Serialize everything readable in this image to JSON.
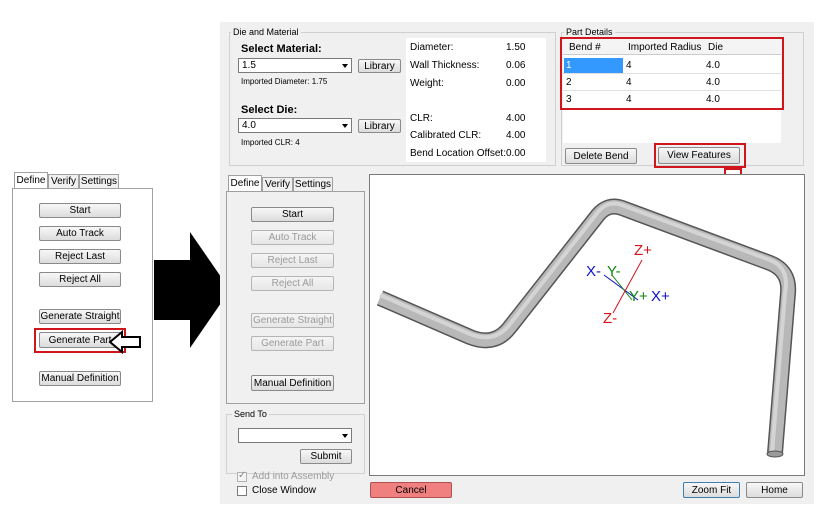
{
  "left_panel": {
    "tabs": [
      "Define",
      "Verify",
      "Settings"
    ],
    "buttons": [
      "Start",
      "Auto Track",
      "Reject Last",
      "Reject All",
      "Generate Straight",
      "Generate Part",
      "Manual Definition"
    ]
  },
  "main": {
    "die_material": {
      "title": "Die and Material",
      "select_material_label": "Select Material:",
      "material_value": "1.5",
      "library_label": "Library",
      "imported_diameter": "Imported Diameter: 1.75",
      "select_die_label": "Select Die:",
      "die_value": "4.0",
      "imported_clr": "Imported CLR: 4",
      "props": [
        {
          "label": "Diameter:",
          "value": "1.50"
        },
        {
          "label": "Wall Thickness:",
          "value": "0.06"
        },
        {
          "label": "Weight:",
          "value": "0.00"
        },
        {
          "label": "CLR:",
          "value": "4.00"
        },
        {
          "label": "Calibrated CLR:",
          "value": "4.00"
        },
        {
          "label": "Bend Location Offset:",
          "value": "0.00"
        }
      ]
    },
    "part_details": {
      "title": "Part Details",
      "columns": [
        "Bend #",
        "Imported Radius",
        "Die"
      ],
      "rows": [
        [
          "1",
          "4",
          "4.0"
        ],
        [
          "2",
          "4",
          "4.0"
        ],
        [
          "3",
          "4",
          "4.0"
        ]
      ],
      "delete_bend_label": "Delete Bend",
      "view_features_label": "View Features"
    },
    "define_panel": {
      "tabs": [
        "Define",
        "Verify",
        "Settings"
      ],
      "buttons": [
        "Start",
        "Auto Track",
        "Reject Last",
        "Reject All",
        "Generate Straight",
        "Generate Part",
        "Manual Definition"
      ]
    },
    "send_to": {
      "title": "Send To",
      "select_value": "",
      "submit_label": "Submit",
      "add_assembly_label": "Add into Assembly",
      "close_window_label": "Close Window"
    },
    "axes": {
      "x_neg": "X-",
      "y_neg": "Y-",
      "z_pos": "Z+",
      "y_pos": "Y+",
      "x_pos": "X+",
      "z_neg": "Z-"
    },
    "bottom": {
      "cancel_label": "Cancel",
      "zoom_fit_label": "Zoom Fit",
      "home_label": "Home"
    }
  },
  "colors": {
    "highlight_red": "#d0151c",
    "axis_blue": "#1010d0",
    "axis_green": "#118811",
    "cancel_bg": "#f08080",
    "selection_blue": "#3399ff"
  }
}
